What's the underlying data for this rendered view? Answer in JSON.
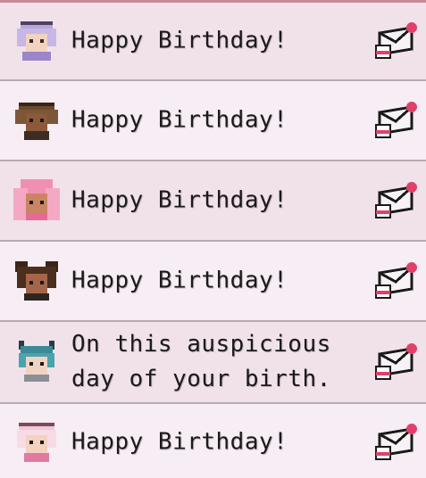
{
  "colors": {
    "row_light": "#f7edf4",
    "row_shade": "#f1e2ea",
    "divider": "#b8aab5",
    "top_border": "#c98a9a",
    "text": "#1a1a1a",
    "envelope_dot": "#e0406a"
  },
  "messages": [
    {
      "sender_icon": "white-haired-villager-portrait",
      "text": "Happy Birthday!",
      "action_icon": "envelope-icon"
    },
    {
      "sender_icon": "brown-haired-villager-portrait",
      "text": "Happy Birthday!",
      "action_icon": "envelope-icon"
    },
    {
      "sender_icon": "pink-haired-villager-portrait",
      "text": "Happy Birthday!",
      "action_icon": "envelope-icon"
    },
    {
      "sender_icon": "dark-haired-villager-portrait",
      "text": "Happy Birthday!",
      "action_icon": "envelope-icon"
    },
    {
      "sender_icon": "teal-haired-villager-portrait",
      "text": "On this auspicious\nday of your birth.",
      "action_icon": "envelope-icon"
    },
    {
      "sender_icon": "pink-white-haired-villager-portrait",
      "text": "Happy Birthday!",
      "action_icon": "envelope-icon"
    }
  ]
}
